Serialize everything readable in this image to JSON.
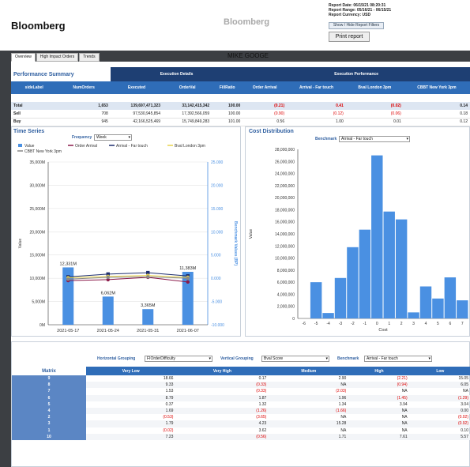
{
  "header": {
    "logo": "Bloomberg",
    "center_logo": "Bloomberg",
    "report_date": "Report Date: 06/15/21 08:20:31",
    "report_range": "Report Range: 05/16/21 - 06/15/21",
    "report_currency": "Report Currency: USD",
    "filter_button": "Show / Hide Report Filters",
    "print_button": "Print report"
  },
  "tabs": [
    {
      "label": "Overview"
    },
    {
      "label": "High Impact Orders"
    },
    {
      "label": "Trends"
    }
  ],
  "person_name": "MIKE GOOGE",
  "performance": {
    "title": "Performance Summary",
    "group_execution": "Execution Details",
    "group_performance": "Execution Performance",
    "columns": [
      "sideLabel",
      "NumOrders",
      "Executed",
      "OrderVal",
      "FillRatio",
      "Order Arrival",
      "Arrival - Far touch",
      "Bval London 3pm",
      "CBBT New York 3pm"
    ],
    "rows": [
      [
        "Total",
        "1,653",
        "139,697,471,323",
        "33,142,415,342",
        "100.00",
        "(0.21)",
        "0.41",
        "(0.02)",
        "0.14"
      ],
      [
        "Sell",
        "708",
        "97,530,945,854",
        "17,392,566,059",
        "100.00",
        "(0.90)",
        "(0.12)",
        "(0.06)",
        "0.18"
      ],
      [
        "Buy",
        "945",
        "42,166,525,469",
        "15,749,849,283",
        "101.00",
        "0.56",
        "1.00",
        "0.01",
        "0.12"
      ]
    ]
  },
  "time_series": {
    "title": "Time Series",
    "frequency_label": "Frequency",
    "frequency_value": "Week",
    "legend": [
      "Value",
      "Order Arrival",
      "Arrival - Far touch",
      "Bval London 3pm",
      "CBBT New York 3pm"
    ],
    "ylabel_left": "Value",
    "ylabel_right": "Benchmark Values (BP)"
  },
  "cost_distribution": {
    "title": "Cost Distribution",
    "benchmark_label": "Benchmark",
    "benchmark_value": "Arrival - Far touch",
    "xlabel": "Cost",
    "ylabel": "Value"
  },
  "matrix": {
    "hgroup_label": "Horizontal Grouping",
    "hgroup_value": "FIOrderDifficulty",
    "vgroup_label": "Vertical Grouping",
    "vgroup_value": "Bval Score",
    "benchmark_label": "Benchmark",
    "benchmark_value": "Arrival - Far touch",
    "columns": [
      "Matrix",
      "Very Low",
      "Very High",
      "Medium",
      "High",
      "Low"
    ],
    "rows": [
      [
        "9",
        "18.66",
        "0.17",
        "2.90",
        "(2.21)",
        "15.05"
      ],
      [
        "8",
        "9.33",
        "(0.33)",
        "NA",
        "(0.94)",
        "6.05"
      ],
      [
        "7",
        "1.53",
        "(0.33)",
        "(2.03)",
        "NA",
        "NA"
      ],
      [
        "6",
        "8.79",
        "1.87",
        "1.96",
        "(1.45)",
        "(1.29)"
      ],
      [
        "5",
        "0.37",
        "1.32",
        "1.34",
        "3.94",
        "3.04"
      ],
      [
        "4",
        "1.69",
        "(1.26)",
        "(1.66)",
        "NA",
        "0.00"
      ],
      [
        "2",
        "(0.53)",
        "(3.65)",
        "NA",
        "NA",
        "(0.02)"
      ],
      [
        "3",
        "1.79",
        "4.23",
        "15.28",
        "NA",
        "(0.92)"
      ],
      [
        "1",
        "(0.02)",
        "3.62",
        "NA",
        "NA",
        "0.10"
      ],
      [
        "10",
        "7.23",
        "(0.56)",
        "1.71",
        "7.61",
        "5.57"
      ]
    ]
  },
  "chart_data": [
    {
      "type": "bar",
      "title": "Time Series",
      "categories": [
        "2021-05-17",
        "2021-05-24",
        "2021-05-31",
        "2021-06-07"
      ],
      "series": [
        {
          "name": "Value",
          "values": [
            12331,
            6062,
            3365,
            11383
          ],
          "labels": [
            "12,331M",
            "6,062M",
            "3,365M",
            "11,383M"
          ],
          "color": "#4a90e2"
        },
        {
          "name": "Order Arrival",
          "values": [
            -0.5,
            -0.3,
            0.2,
            -0.8
          ],
          "color": "#8b1a4a"
        },
        {
          "name": "Arrival - Far touch",
          "values": [
            0.3,
            0.9,
            1.2,
            0.5
          ],
          "color": "#1e2e6e"
        },
        {
          "name": "Bval London 3pm",
          "values": [
            0.1,
            0.4,
            0.6,
            0.2
          ],
          "color": "#e8d24a"
        },
        {
          "name": "CBBT New York 3pm",
          "values": [
            -0.2,
            0.2,
            0.3,
            0.0
          ],
          "color": "#888888"
        }
      ],
      "yticks_left": [
        "0M",
        "5,000M",
        "10,000M",
        "15,000M",
        "20,000M",
        "25,000M",
        "30,000M",
        "35,000M"
      ],
      "yticks_right": [
        "-10.000",
        "-5.000",
        "0.000",
        "5.000",
        "10.000",
        "15.000",
        "20.000",
        "25.000"
      ],
      "ylim": [
        0,
        35000
      ],
      "ylim_right": [
        -10,
        25
      ]
    },
    {
      "type": "bar",
      "title": "Cost Distribution",
      "categories": [
        "-6",
        "-5",
        "-4",
        "-3",
        "-2",
        "-1",
        "0",
        "1",
        "2",
        "3",
        "4",
        "5",
        "6",
        "7"
      ],
      "values": [
        0,
        6000000,
        900000,
        6700000,
        11800000,
        14700000,
        27000000,
        17700000,
        16400000,
        1000000,
        5300000,
        3300000,
        6800000,
        3000000
      ],
      "ylim": [
        0,
        28000000
      ],
      "yticks": [
        "0",
        "2,000,000",
        "4,000,000",
        "6,000,000",
        "8,000,000",
        "10,000,000",
        "12,000,000",
        "14,000,000",
        "16,000,000",
        "18,000,000",
        "20,000,000",
        "22,000,000",
        "24,000,000",
        "26,000,000",
        "28,000,000"
      ],
      "color": "#4a90e2"
    }
  ]
}
